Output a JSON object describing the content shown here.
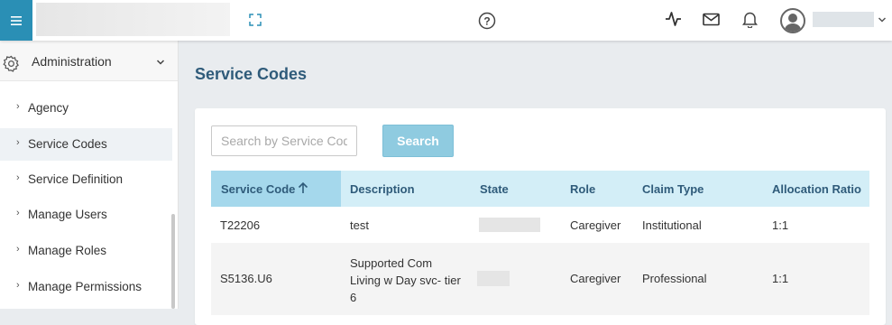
{
  "header": {
    "menu_icon": "hamburger-icon",
    "expand_icon": "fullscreen-icon",
    "help_icon": "help-circle-icon",
    "activity_icon": "activity-icon",
    "mail_icon": "mail-icon",
    "bell_icon": "bell-icon",
    "accent_color": "#2a8fb5"
  },
  "sidebar": {
    "section_label": "Administration",
    "items": [
      {
        "label": "Agency"
      },
      {
        "label": "Service Codes",
        "active": true
      },
      {
        "label": "Service Definition"
      },
      {
        "label": "Manage Users"
      },
      {
        "label": "Manage Roles"
      },
      {
        "label": "Manage Permissions"
      }
    ]
  },
  "main": {
    "title": "Service Codes",
    "search": {
      "placeholder": "Search by Service Code",
      "value": "",
      "button_label": "Search"
    },
    "table": {
      "columns": [
        "Service Code",
        "Description",
        "State",
        "Role",
        "Claim Type",
        "Allocation Ratio"
      ],
      "sorted_column": "Service Code",
      "sort_direction": "ascending",
      "rows": [
        {
          "service_code": "T22206",
          "description": "test",
          "state": "",
          "role": "Caregiver",
          "claim_type": "Institutional",
          "allocation_ratio": "1:1"
        },
        {
          "service_code": "S5136.U6",
          "description_lines": [
            "Supported Com",
            "Living w Day svc- tier",
            "6"
          ],
          "state": "",
          "role": "Caregiver",
          "claim_type": "Professional",
          "allocation_ratio": "1:1"
        }
      ]
    }
  }
}
